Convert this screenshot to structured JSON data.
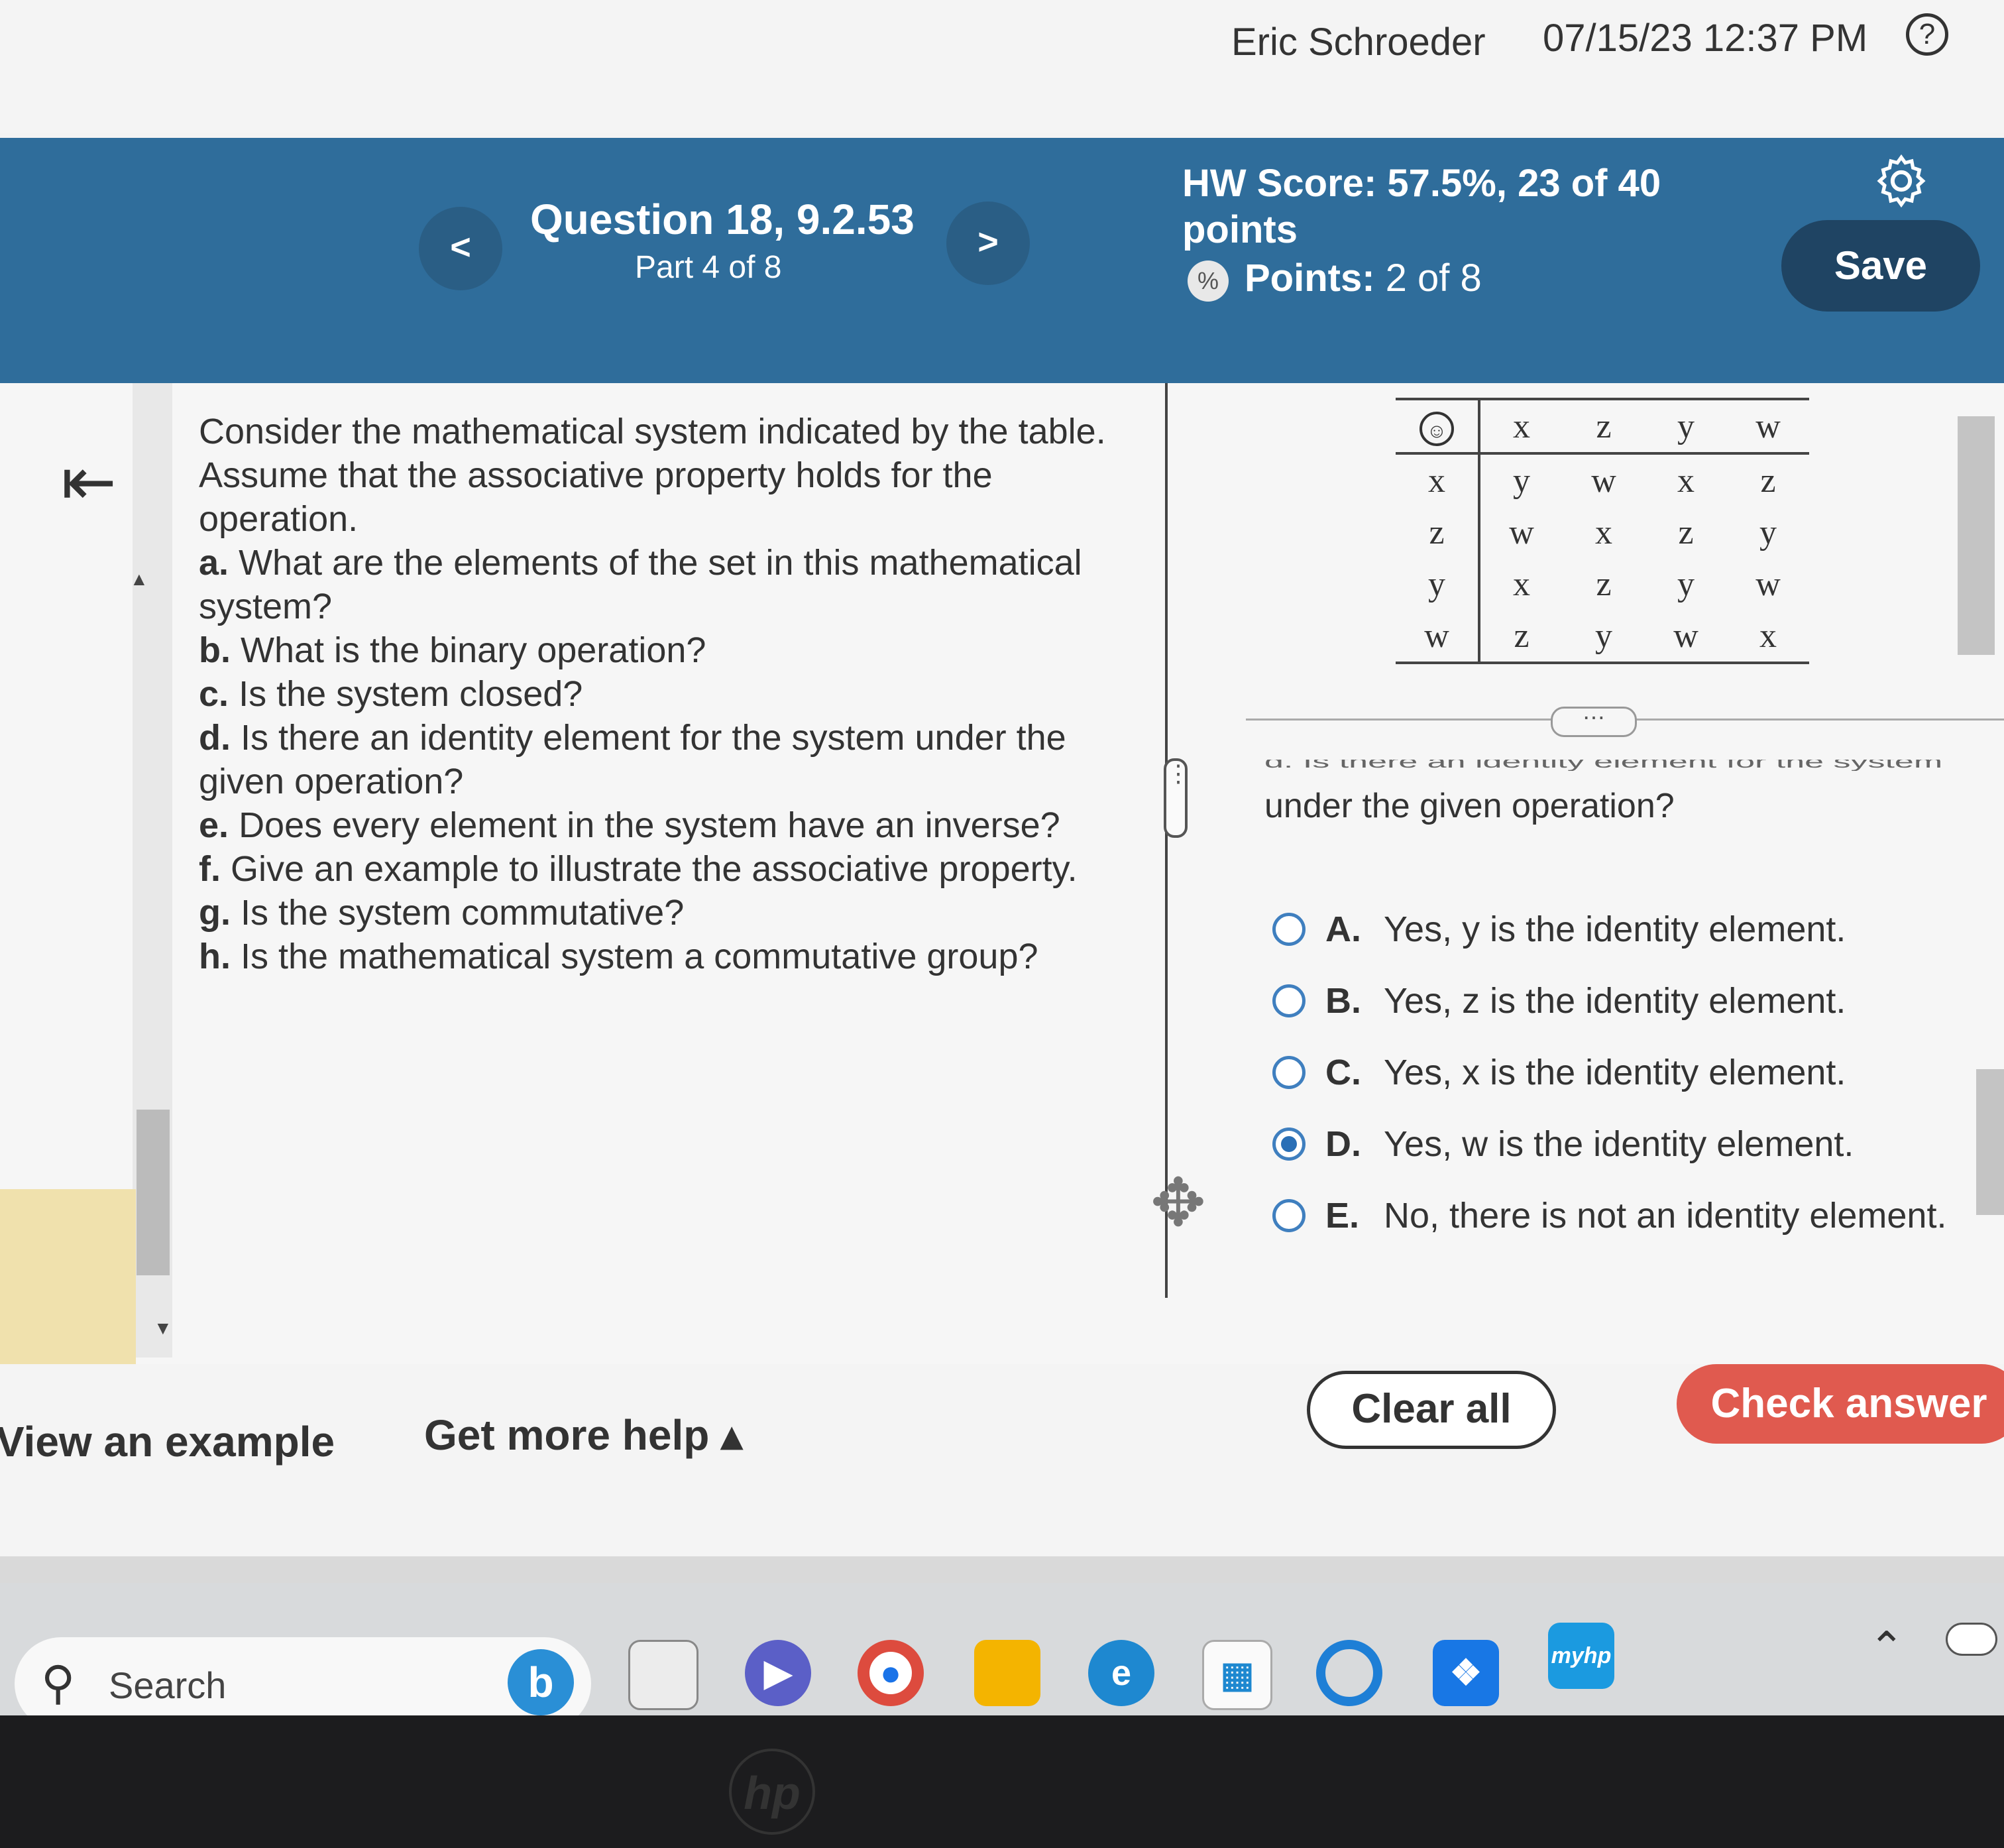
{
  "topbar": {
    "user": "Eric Schroeder",
    "datetime": "07/15/23 12:37 PM",
    "help_icon": "?"
  },
  "header": {
    "prev_label": "<",
    "next_label": ">",
    "question_title": "Question 18, 9.2.53",
    "question_part": "Part 4 of 8",
    "hw_score_label": "HW Score:",
    "hw_score_value": "57.5%, 23 of 40 points",
    "points_label": "Points:",
    "points_value": "2 of 8",
    "save_label": "Save"
  },
  "prompt": {
    "intro": "Consider the mathematical system indicated by the table. Assume that the associative property holds for the operation.",
    "items": [
      {
        "letter": "a.",
        "text": "What are the elements of the set in this mathematical system?"
      },
      {
        "letter": "b.",
        "text": "What is the binary operation?"
      },
      {
        "letter": "c.",
        "text": "Is the system closed?"
      },
      {
        "letter": "d.",
        "text": "Is there an identity element for the system under the given operation?"
      },
      {
        "letter": "e.",
        "text": "Does every element in the system have an inverse?"
      },
      {
        "letter": "f.",
        "text": "Give an example to illustrate the associative property."
      },
      {
        "letter": "g.",
        "text": "Is the system commutative?"
      },
      {
        "letter": "h.",
        "text": "Is the mathematical system a commutative group?"
      }
    ]
  },
  "operation_table": {
    "symbol": "☺",
    "columns": [
      "x",
      "z",
      "y",
      "w"
    ],
    "rows": [
      {
        "label": "x",
        "cells": [
          "y",
          "w",
          "x",
          "z"
        ]
      },
      {
        "label": "z",
        "cells": [
          "w",
          "x",
          "z",
          "y"
        ]
      },
      {
        "label": "y",
        "cells": [
          "x",
          "z",
          "y",
          "w"
        ]
      },
      {
        "label": "w",
        "cells": [
          "z",
          "y",
          "w",
          "x"
        ]
      }
    ]
  },
  "question": {
    "text_partial": "d. Is there an identity element for the system",
    "text": "under the given operation?",
    "options": [
      {
        "letter": "A.",
        "text": "Yes, y is the identity element.",
        "selected": false
      },
      {
        "letter": "B.",
        "text": "Yes, z is the identity element.",
        "selected": false
      },
      {
        "letter": "C.",
        "text": "Yes, x is the identity element.",
        "selected": false
      },
      {
        "letter": "D.",
        "text": "Yes, w is the identity element.",
        "selected": true
      },
      {
        "letter": "E.",
        "text": "No, there is not an identity element.",
        "selected": false
      }
    ]
  },
  "footer": {
    "view_example": "View an example",
    "more_help": "Get more help ▴",
    "clear_all": "Clear all",
    "check_answer": "Check answer"
  },
  "taskbar": {
    "search_placeholder": "Search",
    "myhp_label": "myhp"
  },
  "bezel": {
    "logo": "hp"
  },
  "colors": {
    "header_blue": "#2f6d9b",
    "save_bg": "#1f4463",
    "check_answer_bg": "#e05a4f",
    "radio_accent": "#2a6fb6"
  }
}
